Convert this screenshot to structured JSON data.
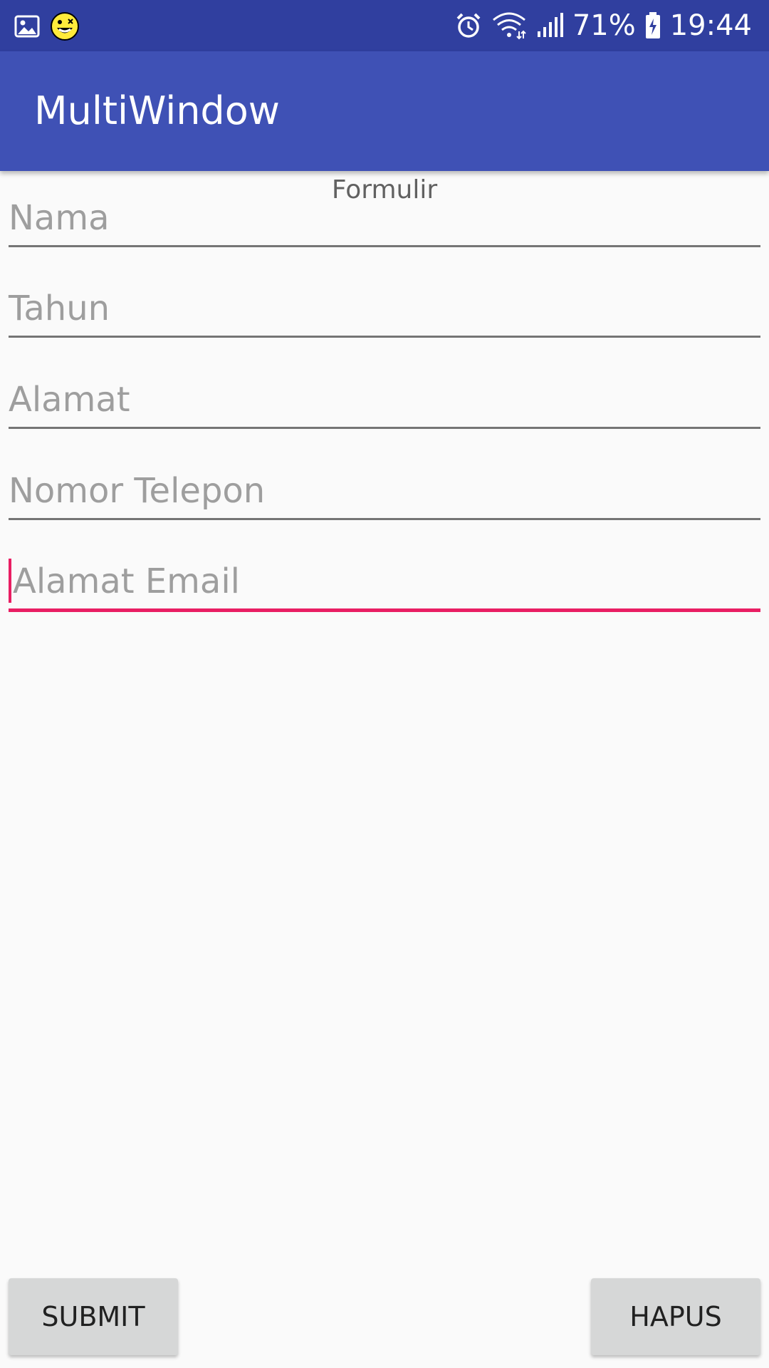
{
  "status_bar": {
    "battery": "71%",
    "time": "19:44",
    "left_icons": [
      "gallery-icon",
      "emoji-icon"
    ],
    "right_icons": [
      "alarm-icon",
      "wifi-icon",
      "signal-icon",
      "battery-icon"
    ]
  },
  "app_bar": {
    "title": "MultiWindow"
  },
  "form": {
    "heading": "Formulir",
    "fields": [
      {
        "placeholder": "Nama",
        "value": ""
      },
      {
        "placeholder": "Tahun",
        "value": ""
      },
      {
        "placeholder": "Alamat",
        "value": ""
      },
      {
        "placeholder": "Nomor Telepon",
        "value": ""
      },
      {
        "placeholder": "Alamat Email",
        "value": ""
      }
    ]
  },
  "buttons": {
    "submit": "SUBMIT",
    "hapus": "HAPUS"
  },
  "colors": {
    "status_bar": "#303f9f",
    "app_bar": "#3f51b5",
    "accent": "#e91e63",
    "button": "#d6d7d7"
  }
}
